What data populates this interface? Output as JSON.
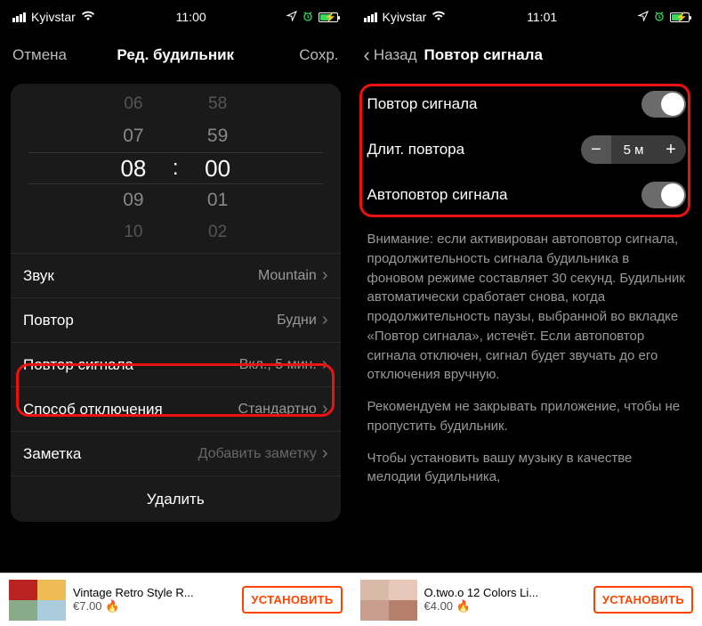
{
  "left": {
    "status": {
      "carrier": "Kyivstar",
      "time": "11:00"
    },
    "nav": {
      "cancel": "Отмена",
      "title": "Ред. будильник",
      "save": "Сохр."
    },
    "picker": {
      "h": {
        "p2": "06",
        "p1": "07",
        "sel": "08",
        "n1": "09",
        "n2": "10"
      },
      "m": {
        "p2": "58",
        "p1": "59",
        "sel": "00",
        "n1": "01",
        "n2": "02"
      },
      "colon": ":"
    },
    "rows": {
      "sound": {
        "label": "Звук",
        "value": "Mountain"
      },
      "repeat": {
        "label": "Повтор",
        "value": "Будни"
      },
      "snooze": {
        "label": "Повтор сигнала",
        "value": "Вкл., 5 мин."
      },
      "dismiss": {
        "label": "Способ отключения",
        "value": "Стандартно"
      },
      "note": {
        "label": "Заметка",
        "placeholder": "Добавить заметку"
      }
    },
    "delete": "Удалить",
    "ad": {
      "title": "Vintage Retro Style R...",
      "price": "€7.00 🔥",
      "cta": "УСТАНОВИТЬ"
    }
  },
  "right": {
    "status": {
      "carrier": "Kyivstar",
      "time": "11:01"
    },
    "nav": {
      "back": "Назад",
      "title": "Повтор сигнала"
    },
    "rows": {
      "snooze": {
        "label": "Повтор сигнала",
        "on": true
      },
      "duration": {
        "label": "Длит. повтора",
        "value": "5 м"
      },
      "auto": {
        "label": "Автоповтор сигнала",
        "on": true
      }
    },
    "desc": {
      "p1": "Внимание: если активирован автоповтор сигнала, продолжительность сигнала будильника в фоновом режиме составляет 30 секунд. Будильник автоматически сработает снова, когда продолжительность паузы, выбранной во вкладке «Повтор сигнала», истечёт. Если автоповтор сигнала отключен, сигнал будет звучать до его отключения вручную.",
      "p2": "Рекомендуем не закрывать приложение, чтобы не пропустить будильник.",
      "p3": "Чтобы установить вашу музыку в качестве мелодии будильника,"
    },
    "ad": {
      "title": "O.two.o 12 Colors Li...",
      "price": "€4.00 🔥",
      "cta": "УСТАНОВИТЬ"
    }
  }
}
